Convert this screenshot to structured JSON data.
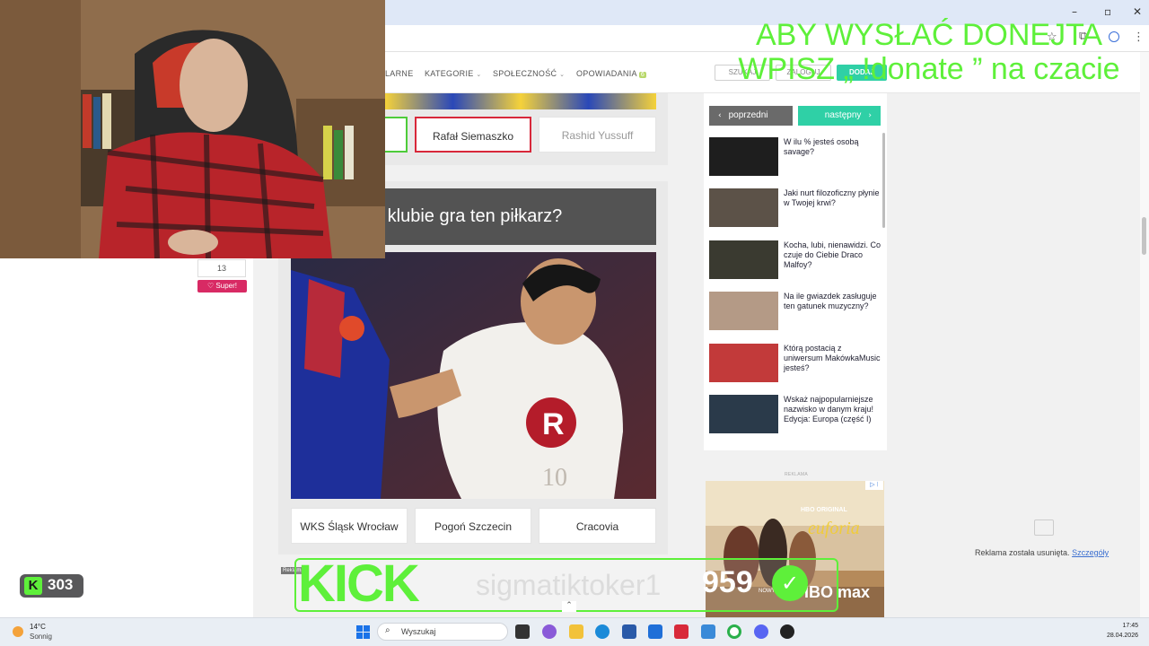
{
  "stream_overlay": {
    "donate_line1": "ABY WYSŁAĆ DONEJTA",
    "donate_line2": "WPISZ „ !donate ” na czacie",
    "kick_logo": "KICK",
    "kick_username": "sigmatiktoker1",
    "kick_username_tail": "959",
    "viewer_badge": "K",
    "viewer_count": "303"
  },
  "site_nav": {
    "items": [
      {
        "label": "LARNE"
      },
      {
        "label": "KATEGORIE"
      },
      {
        "label": "SPOŁECZNOŚĆ"
      },
      {
        "label": "OPOWIADANIA",
        "badge": "6"
      }
    ],
    "search_label": "SZUKAJ",
    "login_label": "ZALOGUJ",
    "add_label": "DODAJ"
  },
  "quiz": {
    "prev_answers": [
      "",
      "Rafał Siemaszko",
      "Rashid Yussuff"
    ],
    "question": "W jakim klubie gra ten piłkarz?",
    "answers": [
      "WKS Śląsk Wrocław",
      "Pogoń Szczecin",
      "Cracovia"
    ]
  },
  "left_column": {
    "like_count": "13",
    "super_label": "♡ Super!"
  },
  "sidebar": {
    "prev_label": "poprzedni",
    "next_label": "następny",
    "items": [
      {
        "title": "W ilu % jesteś osobą savage?",
        "thumb_color": "#1e1e1e"
      },
      {
        "title": "Jaki nurt filozoficzny płynie w Twojej krwi?",
        "thumb_color": "#5c5248"
      },
      {
        "title": "Kocha, lubi, nienawidzi. Co czuje do Ciebie Draco Malfoy?",
        "thumb_color": "#3a3a30"
      },
      {
        "title": "Na ile gwiazdek zasługuje ten gatunek muzyczny?",
        "thumb_color": "#b49a86"
      },
      {
        "title": "Którą postacią z uniwersum MakówkaMusic jesteś?",
        "thumb_color": "#c23a3a"
      },
      {
        "title": "Wskaż najpopularniejsze nazwisko w danym kraju! Edycja: Europa (część I)",
        "thumb_color": "#2a3a4a"
      }
    ]
  },
  "ad": {
    "label": "REKLAMA",
    "brand_text": "euforia",
    "hbo_text": "HBO ORIGINAL",
    "max_text": "HBO max",
    "cta_text": "NOWY ODC",
    "removed_text": "Reklama została usunięta.",
    "removed_link": "Szczegóły",
    "tag": "Reklama"
  },
  "taskbar": {
    "weather_temp": "14°C",
    "weather_cond": "Sonnig",
    "search_placeholder": "Wyszukaj",
    "time": "17:45",
    "date": "28.04.2026"
  }
}
